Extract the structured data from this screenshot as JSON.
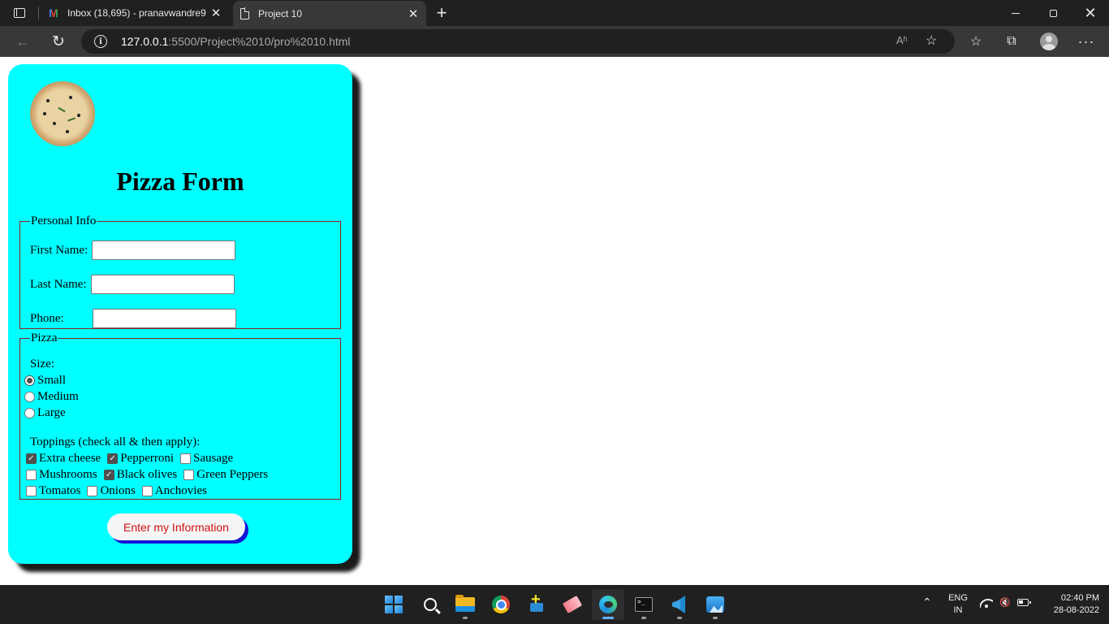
{
  "browser": {
    "tabs": [
      {
        "title": "Inbox (18,695) - pranavwandre98",
        "icon": "gmail-icon",
        "active": false
      },
      {
        "title": "Project 10",
        "icon": "document-icon",
        "active": true
      }
    ],
    "address": {
      "host": "127.0.0.1",
      "path": ":5500/Project%2010/pro%2010.html"
    },
    "glyphs": {
      "close": "✕",
      "new_tab": "+",
      "back": "←",
      "reload": "↻",
      "info": "i",
      "read_aloud": "Aʱ",
      "add_favorite": "☆",
      "favorites": "☆",
      "collections": "⧉",
      "more": "···",
      "chevron_up": "⌃"
    }
  },
  "page": {
    "title": "Pizza Form",
    "personal": {
      "legend": "Personal Info",
      "first_name_label": "First Name:",
      "last_name_label": "Last Name:",
      "phone_label": "Phone:",
      "first_name_value": "",
      "last_name_value": "",
      "phone_value": ""
    },
    "pizza": {
      "legend": "Pizza",
      "size_label": "Size:",
      "sizes": [
        {
          "label": "Small",
          "checked": true
        },
        {
          "label": "Medium",
          "checked": false
        },
        {
          "label": "Large",
          "checked": false
        }
      ],
      "toppings_label": "Toppings (check all & then apply):",
      "toppings": [
        {
          "label": "Extra cheese",
          "checked": true
        },
        {
          "label": "Pepperroni",
          "checked": true
        },
        {
          "label": "Sausage",
          "checked": false
        },
        {
          "label": "Mushrooms",
          "checked": false
        },
        {
          "label": "Black olives",
          "checked": true
        },
        {
          "label": "Green Peppers",
          "checked": false
        },
        {
          "label": "Tomatos",
          "checked": false
        },
        {
          "label": "Onions",
          "checked": false
        },
        {
          "label": "Anchovies",
          "checked": false
        }
      ],
      "check_glyph": "✓"
    },
    "submit_label": "Enter my Information",
    "colors": {
      "card_background": "#00ffff",
      "fieldset_border": "#8b2222",
      "submit_text": "#d01010",
      "submit_shadow": "#1515d6"
    }
  },
  "taskbar": {
    "icons": [
      "start-icon",
      "search-icon",
      "file-explorer-icon",
      "chrome-icon",
      "app-installer-icon",
      "eraser-app-icon",
      "edge-icon",
      "terminal-icon",
      "vscode-icon",
      "photos-icon"
    ],
    "active": "edge-icon",
    "language_top": "ENG",
    "language_bottom": "IN",
    "time": "02:40 PM",
    "date": "28-08-2022",
    "volume_glyph": "🔇"
  }
}
